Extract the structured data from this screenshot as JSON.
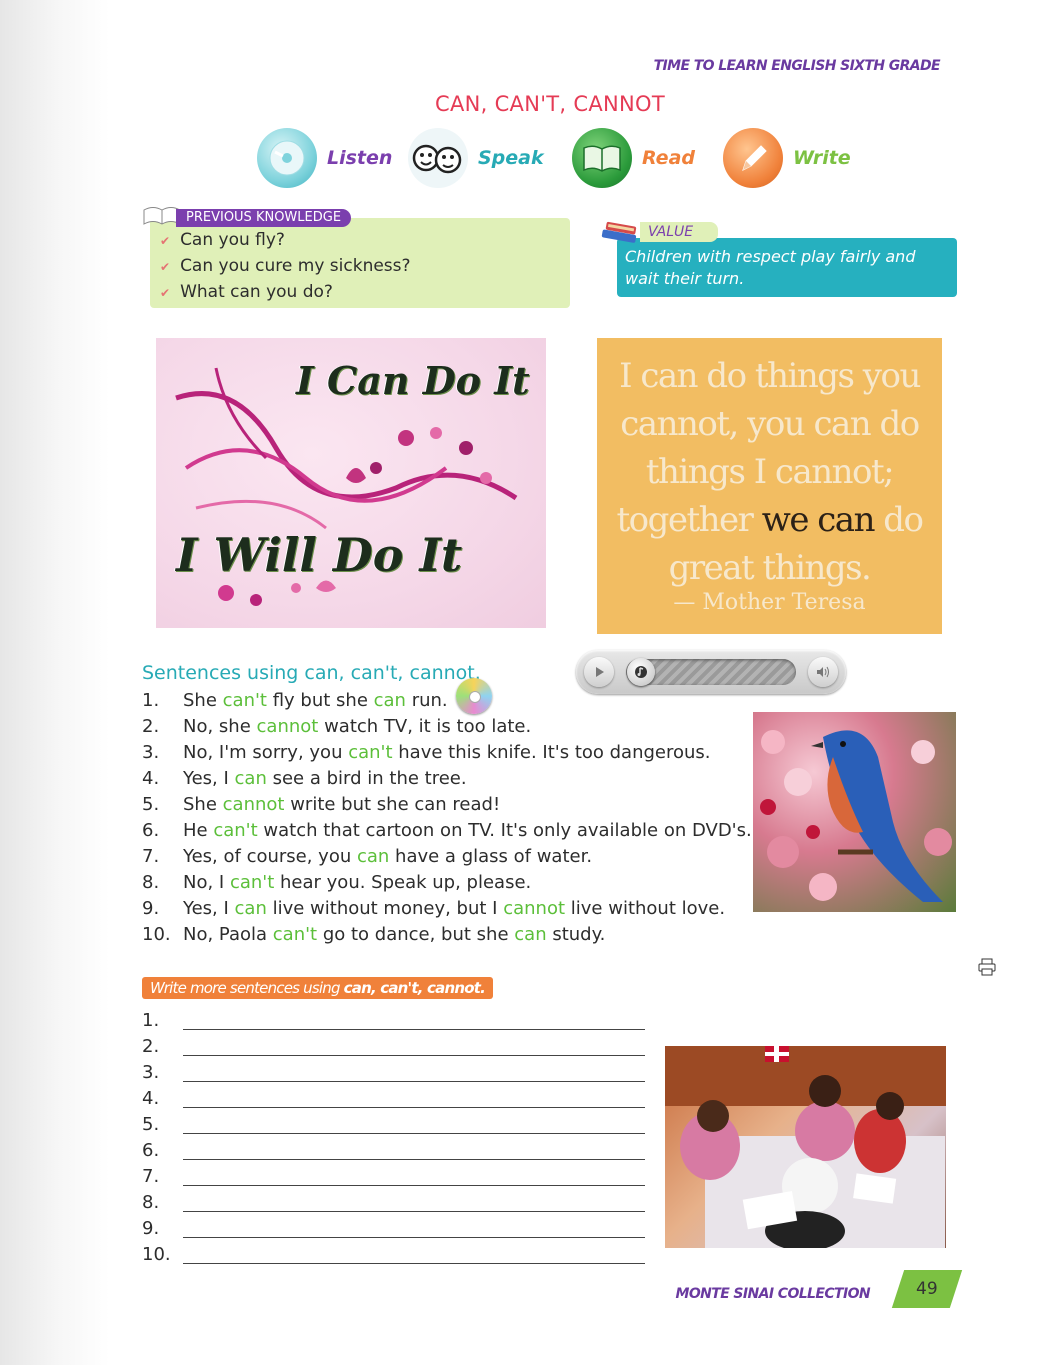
{
  "header": {
    "series": "TIME TO LEARN ENGLISH SIXTH GRADE",
    "title": "CAN, CAN'T, CANNOT"
  },
  "skills": [
    {
      "label": "Listen",
      "color": "#7b3fae"
    },
    {
      "label": "Speak",
      "color": "#27aab5"
    },
    {
      "label": "Read",
      "color": "#f0813a"
    },
    {
      "label": "Write",
      "color": "#7cc142"
    }
  ],
  "previous_knowledge": {
    "tag": "PREVIOUS KNOWLEDGE",
    "items": [
      "Can you fly?",
      "Can you cure my sickness?",
      "What can you do?"
    ]
  },
  "value": {
    "tag": "VALUE",
    "text": "Children with respect play fairly and wait their turn."
  },
  "image_left": {
    "line1": "I Can Do It",
    "line2": "I Will Do It"
  },
  "image_right": {
    "lines": [
      "I can do things you",
      "cannot, you can do",
      "things I cannot;"
    ],
    "line4_pre": "together ",
    "line4_dark": "we can",
    "line4_post": " do",
    "line5": "great things.",
    "author": "— Mother Teresa"
  },
  "sentences": {
    "heading": "Sentences using can, can't, cannot.",
    "items": [
      {
        "num": "1.",
        "parts": [
          [
            "She ",
            0
          ],
          [
            "can't",
            1
          ],
          [
            " fly but she ",
            0
          ],
          [
            "can",
            1
          ],
          [
            " run.",
            0
          ]
        ]
      },
      {
        "num": "2.",
        "parts": [
          [
            "No, she ",
            0
          ],
          [
            "cannot",
            1
          ],
          [
            " watch TV, it is too late.",
            0
          ]
        ]
      },
      {
        "num": "3.",
        "parts": [
          [
            "No, I'm sorry, you ",
            0
          ],
          [
            "can't",
            1
          ],
          [
            " have this knife. It's too dangerous.",
            0
          ]
        ]
      },
      {
        "num": "4.",
        "parts": [
          [
            "Yes, I ",
            0
          ],
          [
            "can",
            1
          ],
          [
            " see a bird in the tree.",
            0
          ]
        ]
      },
      {
        "num": "5.",
        "parts": [
          [
            "She ",
            0
          ],
          [
            "cannot",
            1
          ],
          [
            " write but she can read!",
            0
          ]
        ]
      },
      {
        "num": "6.",
        "parts": [
          [
            "He ",
            0
          ],
          [
            "can't",
            1
          ],
          [
            " watch that cartoon on TV. It's only available on DVD's.",
            0
          ]
        ]
      },
      {
        "num": "7.",
        "parts": [
          [
            "Yes, of course, you ",
            0
          ],
          [
            "can",
            1
          ],
          [
            " have a glass of water.",
            0
          ]
        ]
      },
      {
        "num": "8.",
        "parts": [
          [
            "No, I ",
            0
          ],
          [
            "can't",
            1
          ],
          [
            " hear you. Speak up, please.",
            0
          ]
        ]
      },
      {
        "num": "9.",
        "parts": [
          [
            "Yes, I ",
            0
          ],
          [
            "can",
            1
          ],
          [
            " live without money, but I ",
            0
          ],
          [
            "cannot",
            1
          ],
          [
            " live without love.",
            0
          ]
        ]
      },
      {
        "num": "10.",
        "parts": [
          [
            "No, Paola ",
            0
          ],
          [
            "can't",
            1
          ],
          [
            " go to dance, but she ",
            0
          ],
          [
            "can",
            1
          ],
          [
            " study.",
            0
          ]
        ]
      }
    ]
  },
  "write_section": {
    "tag_prefix": "Write more sentences using ",
    "tag_bold": "can, can't, cannot.",
    "numbers": [
      "1.",
      "2.",
      "3.",
      "4.",
      "5.",
      "6.",
      "7.",
      "8.",
      "9.",
      "10."
    ]
  },
  "footer": {
    "collection": "MONTE SINAI COLLECTION",
    "page": "49"
  }
}
